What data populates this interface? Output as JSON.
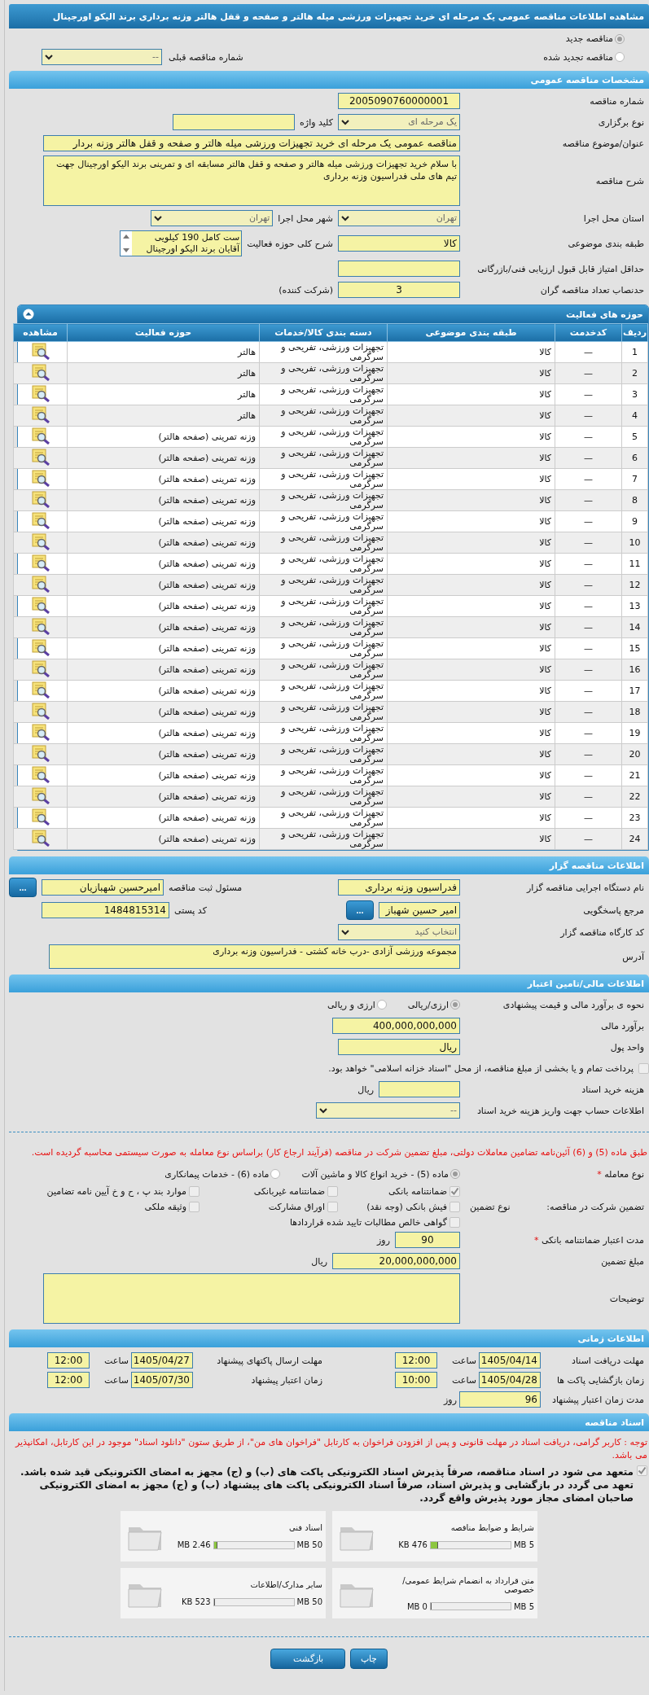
{
  "page_title": "مشاهده اطلاعات مناقصه عمومی یک مرحله ای خرید تجهیزات ورزشی میله هالتر و صفحه و قفل هالتر وزنه برداری برند الیکو اورجینال",
  "tender_status": {
    "options": [
      {
        "label": "مناقصه جدید",
        "selected": true
      },
      {
        "label": "مناقصه تجدید شده",
        "selected": false
      }
    ],
    "previous_label": "شماره مناقصه قبلی",
    "previous_value": "--"
  },
  "general": {
    "title": "مشخصات مناقصه عمومی",
    "rows": [
      [
        {
          "kind": "label",
          "text": "شماره مناقصه"
        },
        {
          "kind": "centered",
          "value": "2005090760000001"
        }
      ],
      [
        {
          "kind": "label",
          "text": "نوع برگزاری"
        },
        {
          "kind": "select",
          "value": "یک مرحله ای"
        },
        {
          "kind": "label",
          "text": "کلید واژه"
        },
        {
          "kind": "input"
        }
      ],
      [
        {
          "kind": "label",
          "text": "عنوان/موضوع مناقصه"
        },
        {
          "kind": "long",
          "value": "مناقصه عمومی یک مرحله ای خرید تجهیزات ورزشی میله هالتر و صفحه و قفل هالتر وزنه بردار"
        }
      ],
      [
        {
          "kind": "label",
          "text": "شرح مناقصه"
        },
        {
          "kind": "textarea",
          "value": "با سلام خرید تجهیزات ورزشی میله هالتر و صفحه  و قفل هالتر مسابقه ای و تمرینی برند الیکو اورجینال جهت تیم های ملی فدراسیون وزنه برداری"
        }
      ],
      [
        {
          "kind": "label",
          "text": "استان محل اجرا"
        },
        {
          "kind": "select",
          "value": "تهران"
        },
        {
          "kind": "label",
          "text": "شهر محل اجرا"
        },
        {
          "kind": "select",
          "value": "تهران"
        }
      ],
      [
        {
          "kind": "label",
          "text": "طبقه بندی موضوعی"
        },
        {
          "kind": "input",
          "value": "کالا"
        },
        {
          "kind": "label",
          "text": "شرح کلی حوزه فعالیت"
        },
        {
          "kind": "listbox",
          "lines": [
            "ست کامل 190 کیلویی",
            "آقایان برند الیکو اورجینال"
          ]
        }
      ],
      [
        {
          "kind": "label",
          "text": "حداقل امتیاز قابل قبول ارزیابی فنی/بازرگانی"
        },
        {
          "kind": "input"
        }
      ],
      [
        {
          "kind": "label",
          "text": "حدنصاب تعداد مناقصه گران"
        },
        {
          "kind": "centered",
          "value": "3"
        },
        {
          "kind": "text",
          "text": "(شرکت کننده)"
        }
      ]
    ]
  },
  "activities": {
    "title": "حوزه های فعالیت",
    "columns": [
      "ردیف",
      "کدخدمت",
      "طبقه بندی موضوعی",
      "دسته بندی کالا/خدمات",
      "حوزه فعالیت",
      "مشاهده"
    ],
    "rows": [
      {
        "index": "1",
        "service_code": "—",
        "classification": "کالا",
        "category": "تجهیزات ورزشی، تفریحی و سرگرمی",
        "activity": "هالتر"
      },
      {
        "index": "2",
        "service_code": "—",
        "classification": "کالا",
        "category": "تجهیزات ورزشی، تفریحی و سرگرمی",
        "activity": "هالتر"
      },
      {
        "index": "3",
        "service_code": "—",
        "classification": "کالا",
        "category": "تجهیزات ورزشی، تفریحی و سرگرمی",
        "activity": "هالتر"
      },
      {
        "index": "4",
        "service_code": "—",
        "classification": "کالا",
        "category": "تجهیزات ورزشی، تفریحی و سرگرمی",
        "activity": "هالتر"
      },
      {
        "index": "5",
        "service_code": "—",
        "classification": "کالا",
        "category": "تجهیزات ورزشی، تفریحی و سرگرمی",
        "activity": "وزنه تمرینی (صفحه هالتر)"
      },
      {
        "index": "6",
        "service_code": "—",
        "classification": "کالا",
        "category": "تجهیزات ورزشی، تفریحی و سرگرمی",
        "activity": "وزنه تمرینی (صفحه هالتر)"
      },
      {
        "index": "7",
        "service_code": "—",
        "classification": "کالا",
        "category": "تجهیزات ورزشی، تفریحی و سرگرمی",
        "activity": "وزنه تمرینی (صفحه هالتر)"
      },
      {
        "index": "8",
        "service_code": "—",
        "classification": "کالا",
        "category": "تجهیزات ورزشی، تفریحی و سرگرمی",
        "activity": "وزنه تمرینی (صفحه هالتر)"
      },
      {
        "index": "9",
        "service_code": "—",
        "classification": "کالا",
        "category": "تجهیزات ورزشی، تفریحی و سرگرمی",
        "activity": "وزنه تمرینی (صفحه هالتر)"
      },
      {
        "index": "10",
        "service_code": "—",
        "classification": "کالا",
        "category": "تجهیزات ورزشی، تفریحی و سرگرمی",
        "activity": "وزنه تمرینی (صفحه هالتر)"
      },
      {
        "index": "11",
        "service_code": "—",
        "classification": "کالا",
        "category": "تجهیزات ورزشی، تفریحی و سرگرمی",
        "activity": "وزنه تمرینی (صفحه هالتر)"
      },
      {
        "index": "12",
        "service_code": "—",
        "classification": "کالا",
        "category": "تجهیزات ورزشی، تفریحی و سرگرمی",
        "activity": "وزنه تمرینی (صفحه هالتر)"
      },
      {
        "index": "13",
        "service_code": "—",
        "classification": "کالا",
        "category": "تجهیزات ورزشی، تفریحی و سرگرمی",
        "activity": "وزنه تمرینی (صفحه هالتر)"
      },
      {
        "index": "14",
        "service_code": "—",
        "classification": "کالا",
        "category": "تجهیزات ورزشی، تفریحی و سرگرمی",
        "activity": "وزنه تمرینی (صفحه هالتر)"
      },
      {
        "index": "15",
        "service_code": "—",
        "classification": "کالا",
        "category": "تجهیزات ورزشی، تفریحی و سرگرمی",
        "activity": "وزنه تمرینی (صفحه هالتر)"
      },
      {
        "index": "16",
        "service_code": "—",
        "classification": "کالا",
        "category": "تجهیزات ورزشی، تفریحی و سرگرمی",
        "activity": "وزنه تمرینی (صفحه هالتر)"
      },
      {
        "index": "17",
        "service_code": "—",
        "classification": "کالا",
        "category": "تجهیزات ورزشی، تفریحی و سرگرمی",
        "activity": "وزنه تمرینی (صفحه هالتر)"
      },
      {
        "index": "18",
        "service_code": "—",
        "classification": "کالا",
        "category": "تجهیزات ورزشی، تفریحی و سرگرمی",
        "activity": "وزنه تمرینی (صفحه هالتر)"
      },
      {
        "index": "19",
        "service_code": "—",
        "classification": "کالا",
        "category": "تجهیزات ورزشی، تفریحی و سرگرمی",
        "activity": "وزنه تمرینی (صفحه هالتر)"
      },
      {
        "index": "20",
        "service_code": "—",
        "classification": "کالا",
        "category": "تجهیزات ورزشی، تفریحی و سرگرمی",
        "activity": "وزنه تمرینی (صفحه هالتر)"
      },
      {
        "index": "21",
        "service_code": "—",
        "classification": "کالا",
        "category": "تجهیزات ورزشی، تفریحی و سرگرمی",
        "activity": "وزنه تمرینی (صفحه هالتر)"
      },
      {
        "index": "22",
        "service_code": "—",
        "classification": "کالا",
        "category": "تجهیزات ورزشی، تفریحی و سرگرمی",
        "activity": "وزنه تمرینی (صفحه هالتر)"
      },
      {
        "index": "23",
        "service_code": "—",
        "classification": "کالا",
        "category": "تجهیزات ورزشی، تفریحی و سرگرمی",
        "activity": "وزنه تمرینی (صفحه هالتر)"
      },
      {
        "index": "24",
        "service_code": "—",
        "classification": "کالا",
        "category": "تجهیزات ورزشی، تفریحی و سرگرمی",
        "activity": "وزنه تمرینی (صفحه هالتر)"
      }
    ]
  },
  "issuer": {
    "title": "اطلاعات مناقصه گزار",
    "rows": [
      [
        {
          "kind": "label",
          "text": "نام دستگاه اجرایی مناقصه گزار"
        },
        {
          "kind": "input",
          "value": "فدراسیون وزنه برداری"
        },
        {
          "kind": "label",
          "text": "مسئول ثبت مناقصه"
        },
        {
          "kind": "input",
          "value": "امیرحسین شهبازیان"
        },
        {
          "kind": "button",
          "text": "..."
        }
      ],
      [
        {
          "kind": "label",
          "text": "مرجع پاسخگویی"
        },
        {
          "kind": "lookup",
          "value": "امیر حسین شهباز",
          "button": "..."
        },
        {
          "kind": "label",
          "text": "کد پستی"
        },
        {
          "kind": "number",
          "value": "1484815314"
        }
      ],
      [
        {
          "kind": "label",
          "text": "کد کارگاه مناقصه گزار"
        },
        {
          "kind": "select",
          "value": "انتخاب کنید"
        }
      ],
      [
        {
          "kind": "label",
          "text": "آدرس"
        },
        {
          "kind": "address",
          "value": "مجموعه ورزشی آزادی -درب خانه کشتی - فدراسیون وزنه برداری"
        }
      ]
    ]
  },
  "finance": {
    "title": "اطلاعات مالی/تامین اعتبار",
    "rows": [
      [
        {
          "kind": "label",
          "text": "نحوه ی برآورد مالی و قیمت پیشنهادی"
        },
        {
          "kind": "radio",
          "text": "ارزی/ریالی",
          "selected": true
        },
        {
          "kind": "radio",
          "text": "ارزی و ریالی",
          "selected": false
        }
      ],
      [
        {
          "kind": "label",
          "text": "برآورد مالی"
        },
        {
          "kind": "number",
          "value": "400,000,000,000"
        }
      ],
      [
        {
          "kind": "label",
          "text": "واحد پول"
        },
        {
          "kind": "input",
          "value": "ریال"
        }
      ],
      [
        {
          "kind": "checkbox",
          "text": "پرداخت تمام و یا بخشی از مبلغ مناقصه، از محل \"اسناد خزانه اسلامی\" خواهد بود.",
          "checked": false
        }
      ],
      [
        {
          "kind": "label",
          "text": "هزینه خرید اسناد"
        },
        {
          "kind": "short"
        },
        {
          "kind": "text",
          "text": "ریال"
        }
      ],
      [
        {
          "kind": "label",
          "text": "اطلاعات حساب جهت واریز هزینه خرید اسناد"
        },
        {
          "kind": "wide_select",
          "value": "--"
        }
      ],
      [
        {
          "kind": "rule"
        }
      ],
      [
        {
          "kind": "note",
          "text": "طبق ماده (5) و (6) آئین‌نامه تضامین معاملات دولتی، مبلغ تضمین شرکت در مناقصه (فرآیند ارجاع کار) براساس نوع معامله به صورت سیستمی محاسبه گردیده است."
        }
      ],
      [
        {
          "kind": "label",
          "text": "نوع معامله",
          "mark": "*"
        },
        {
          "kind": "radio",
          "text": "ماده (5) - خرید انواع کالا و ماشین آلات",
          "selected": true
        },
        {
          "kind": "radio",
          "text": "ماده (6) - خدمات پیمانکاری",
          "selected": false
        }
      ],
      [
        {
          "kind": "label_pair",
          "text": "تضمین شرکت در مناقصه:",
          "sub": "نوع تضمین"
        },
        {
          "kind": "checkgrid",
          "options": [
            {
              "text": "ضمانتنامه بانکی",
              "checked": true
            },
            {
              "text": "ضمانتنامه غیربانکی",
              "checked": false
            },
            {
              "text": "موارد بند پ ، ح و خ آیین نامه تضامین",
              "checked": false
            },
            {
              "text": "فیش بانکی (وجه نقد)",
              "checked": false
            },
            {
              "text": "اوراق مشارکت",
              "checked": false
            },
            {
              "text": "وثیقه ملکی",
              "checked": false
            },
            {
              "text": "گواهی خالص مطالبات تایید شده قراردادها",
              "checked": false
            }
          ]
        }
      ],
      [
        {
          "kind": "label",
          "text": "مدت اعتبار ضمانتنامه بانکی",
          "mark": "*"
        },
        {
          "kind": "small",
          "value": "90"
        },
        {
          "kind": "text",
          "text": "روز"
        }
      ],
      [
        {
          "kind": "label",
          "text": "مبلغ تضمین"
        },
        {
          "kind": "number",
          "value": "20,000,000,000"
        },
        {
          "kind": "text",
          "text": "ریال"
        }
      ],
      [
        {
          "kind": "label",
          "text": "توضیحات"
        },
        {
          "kind": "textarea"
        }
      ]
    ]
  },
  "schedule": {
    "title": "اطلاعات زمانی",
    "entries": [
      {
        "kind": "datetime",
        "label": "مهلت دریافت اسناد",
        "date": "1405/04/14",
        "time_label": "ساعت",
        "time": "12:00"
      },
      {
        "kind": "datetime",
        "label": "مهلت ارسال پاکتهای پیشنهاد",
        "date": "1405/04/27",
        "time_label": "ساعت",
        "time": "12:00"
      },
      {
        "kind": "datetime",
        "label": "زمان بازگشایی پاکت ها",
        "date": "1405/04/28",
        "time_label": "ساعت",
        "time": "10:00"
      },
      {
        "kind": "datetime",
        "label": "زمان اعتبار پیشنهاد",
        "date": "1405/07/30",
        "time_label": "ساعت",
        "time": "12:00"
      },
      {
        "kind": "duration",
        "label": "مدت زمان اعتبار پیشنهاد",
        "value": "96",
        "unit": "روز"
      }
    ]
  },
  "documents": {
    "title": "اسناد مناقصه",
    "notice": "توجه : کاربر گرامی، دریافت اسناد در مهلت قانونی و پس از افزودن فراخوان به کارتابل \"فراخوان های من\"، از طریق ستون \"دانلود اسناد\" موجود در این کارتابل، امکانپذیر می باشد.",
    "commitment": {
      "checked": true,
      "text": "متعهد می شود در اسناد مناقصه، صرفاً پذیرش اسناد الکترونیکی پاکت های (ب) و (ج) مجهز به امضای الکترونیکی قید شده باشد. تعهد می گردد در بازگشایی و پذیرش اسناد، صرفاً اسناد الکترونیکی پاکت های پیشنهاد (ب) و (ج) مجهز به امضای الکترونیکی صاحبان امضای مجاز مورد پذیرش واقع گردد."
    },
    "files": [
      {
        "title": "شرایط و ضوابط مناقصه",
        "max": "5 MB",
        "size": "476 KB",
        "level": 0.093
      },
      {
        "title": "اسناد فنی",
        "max": "50 MB",
        "size": "2.46 MB",
        "level": 0.049
      },
      {
        "title": "متن قرارداد به انضمام شرایط عمومی/خصوصی",
        "max": "5 MB",
        "size": "0 MB",
        "level": 0
      },
      {
        "title": "سایر مدارک/اطلاعات",
        "max": "50 MB",
        "size": "523 KB",
        "level": 0.01
      }
    ]
  },
  "buttons": [
    {
      "kind": "print",
      "label": "چاپ"
    },
    {
      "kind": "back",
      "label": "بازگشت"
    }
  ]
}
